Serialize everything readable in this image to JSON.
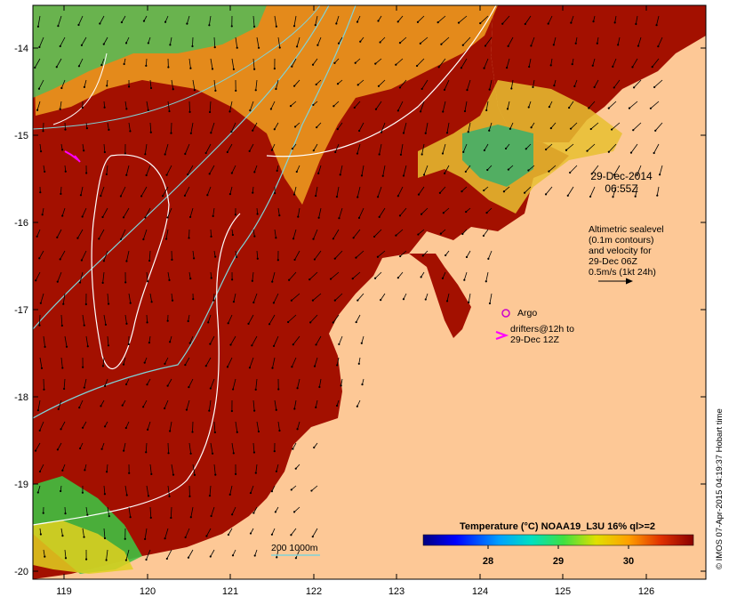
{
  "map": {
    "date": "29-Dec-2014",
    "time": "06:55Z",
    "altimetry_note": [
      "Altimetric sealevel",
      "(0.1m contours)",
      "and velocity for",
      "29-Dec 06Z",
      "0.5m/s (1kt 24h)"
    ],
    "argo_label": "Argo",
    "drifters_label": [
      "drifters@12h to",
      "29-Dec 12Z"
    ],
    "isobath_label": "200  1000m",
    "colorbar_title": "Temperature (°C) NOAA19_L3U 16% ql>=2",
    "colorbar_ticks": [
      "28",
      "29",
      "30"
    ],
    "credit": "© IMOS 07-Apr-2015 04:19:37 Hobart time",
    "x_ticks": [
      "119",
      "120",
      "121",
      "122",
      "123",
      "124",
      "125",
      "126"
    ],
    "y_ticks": [
      "-14",
      "-15",
      "-16",
      "-17",
      "-18",
      "-19",
      "-20"
    ],
    "colors": {
      "land": "#fdc896",
      "warm_sst": "#a31000",
      "isobath_200": "#7fd3d8",
      "sealevel_contour": "#ffffff",
      "drifter": "#ff00ff",
      "argo": "#cc00cc"
    }
  }
}
